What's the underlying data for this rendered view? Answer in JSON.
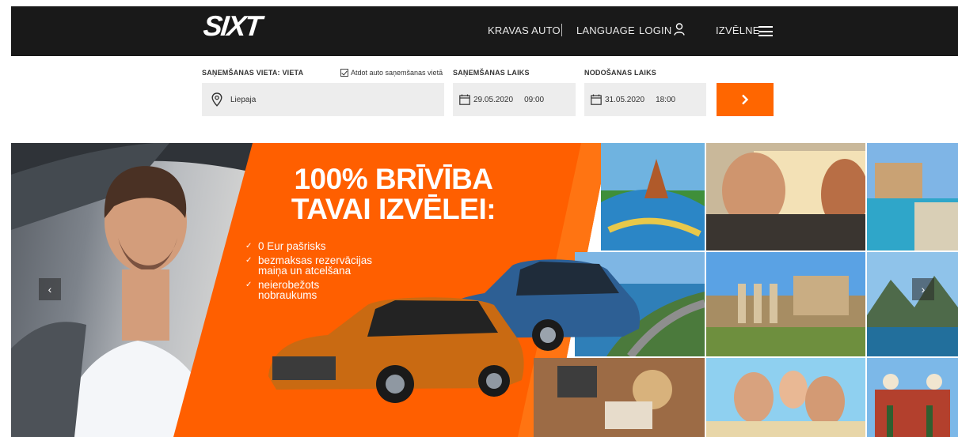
{
  "brand": {
    "logo_text": "SIXT",
    "accent": "#ff6600",
    "header_bg": "#191919"
  },
  "header": {
    "nav": {
      "trucks": "KRAVAS AUTO",
      "language": "LANGUAGE",
      "login": "LOGIN",
      "menu": "IZVĒLNE"
    }
  },
  "booking": {
    "pickup_location_label": "SAŅEMŠANAS VIETA: VIETA",
    "return_same_label": "Atdot auto saņemšanas vietā",
    "return_same_checked": true,
    "pickup_time_label": "SAŅEMŠANAS LAIKS",
    "return_time_label": "NODOŠANAS LAIKS",
    "location_value": "Liepaja",
    "pickup_date": "29.05.2020",
    "pickup_time": "09:00",
    "return_date": "31.05.2020",
    "return_time": "18:00"
  },
  "banner": {
    "headline_line1": "100% BRĪVĪBA",
    "headline_line2": "TAVAI IZVĒLEI:",
    "benefits": [
      "0 Eur pašrisks",
      "bezmaksas rezervācijas maiņa un atcelšana",
      "neierobežots nobraukums"
    ]
  },
  "icons": {
    "user": "user-icon",
    "menu": "hamburger-menu-icon",
    "pin": "location-pin-icon",
    "calendar": "calendar-icon",
    "go": "chevron-right-icon",
    "prev": "chevron-left-icon",
    "next": "chevron-right-icon"
  }
}
